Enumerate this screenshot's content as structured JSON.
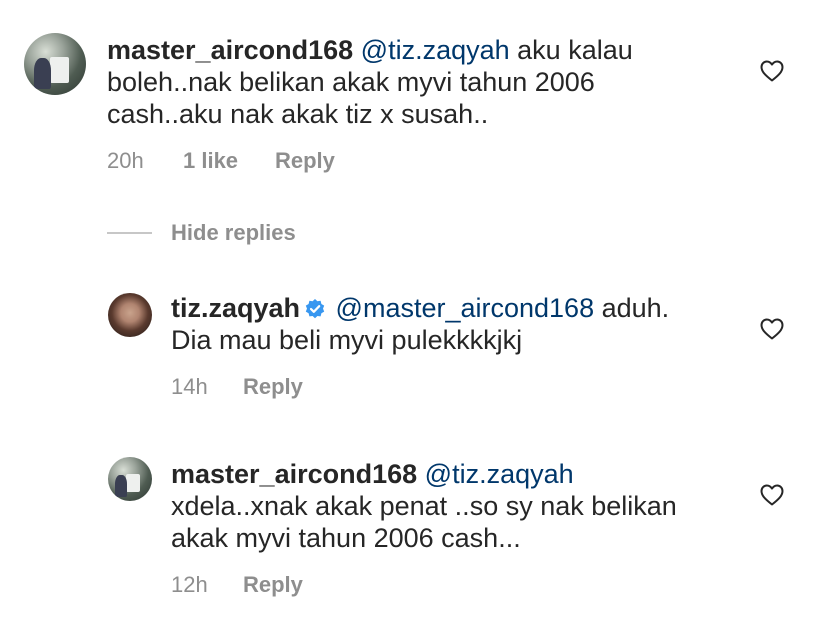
{
  "comments": [
    {
      "username": "master_aircond168",
      "mention": "@tiz.zaqyah",
      "text_line1": "aku kalau",
      "text_line2": "boleh..nak belikan akak myvi tahun 2006",
      "text_line3": "cash..aku nak akak tiz x susah..",
      "time": "20h",
      "likes": "1 like",
      "reply_label": "Reply"
    }
  ],
  "replies_toggle": {
    "label": "Hide replies"
  },
  "replies": [
    {
      "username": "tiz.zaqyah",
      "verified": true,
      "mention": "@master_aircond168",
      "text_line1": "aduh.",
      "text_line2": "Dia mau beli myvi pulekkkkjkj",
      "time": "14h",
      "reply_label": "Reply"
    },
    {
      "username": "master_aircond168",
      "mention": "@tiz.zaqyah",
      "text_line1": "xdela..xnak akak penat ..so sy nak belikan",
      "text_line2": "akak myvi tahun 2006 cash...",
      "time": "12h",
      "reply_label": "Reply"
    }
  ],
  "colors": {
    "mention": "#00376b",
    "meta": "#8e8e8e",
    "verified": "#3897f0",
    "text": "#262626"
  }
}
